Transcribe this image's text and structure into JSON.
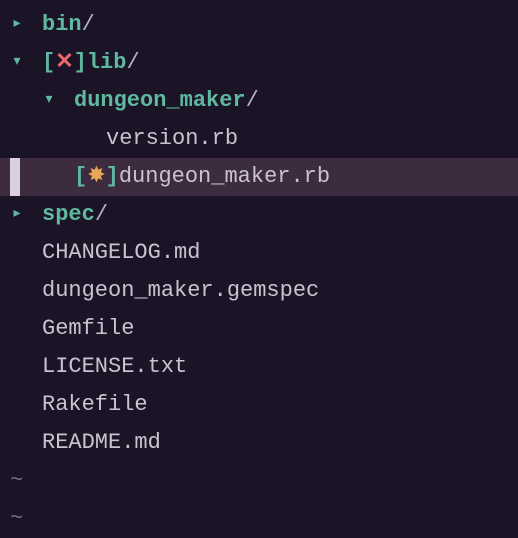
{
  "tree": {
    "bin": {
      "name": "bin",
      "slash": "/"
    },
    "lib": {
      "name": "lib",
      "slash": "/",
      "icon": "✕"
    },
    "dungeon_maker_dir": {
      "name": "dungeon_maker",
      "slash": "/"
    },
    "version_rb": {
      "name": "version.rb"
    },
    "dungeon_maker_rb": {
      "name": "dungeon_maker.rb",
      "icon": "✸"
    },
    "spec": {
      "name": "spec",
      "slash": "/"
    },
    "changelog": {
      "name": "CHANGELOG.md"
    },
    "gemspec": {
      "name": "dungeon_maker.gemspec"
    },
    "gemfile": {
      "name": "Gemfile"
    },
    "license": {
      "name": "LICENSE.txt"
    },
    "rakefile": {
      "name": "Rakefile"
    },
    "readme": {
      "name": "README.md"
    }
  },
  "tilde": "~"
}
